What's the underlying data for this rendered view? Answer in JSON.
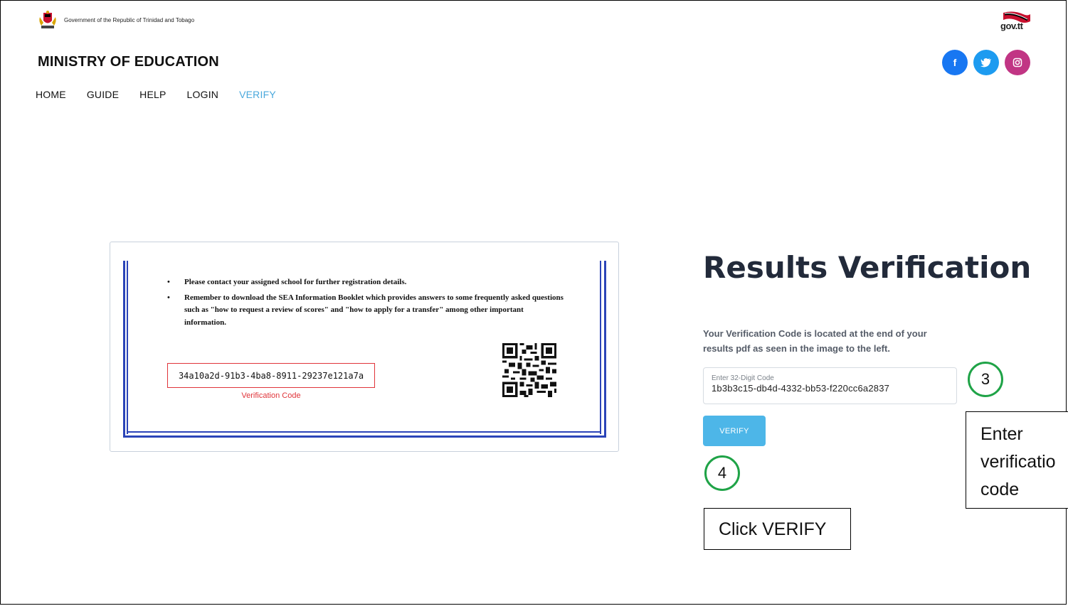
{
  "header": {
    "government_text": "Government of the Republic of Trinidad and Tobago",
    "portal_logo": "gov.tt",
    "ministry": "MINISTRY OF EDUCATION",
    "social": [
      {
        "name": "facebook-icon",
        "glyph": "f",
        "color": "#1877f2"
      },
      {
        "name": "twitter-icon",
        "glyph": "t",
        "color": "#1d9bf0"
      },
      {
        "name": "instagram-icon",
        "glyph": "◎",
        "color": "#c13584"
      }
    ]
  },
  "nav": {
    "items": [
      "HOME",
      "GUIDE",
      "HELP",
      "LOGIN",
      "VERIFY"
    ],
    "active": "VERIFY",
    "accent_color": "#4aa8dc"
  },
  "sample_doc": {
    "bullets": [
      "Please contact your assigned school for further registration details.",
      "Remember to download the SEA Information Booklet which provides answers to some frequently asked questions such as \"how to request a review of scores\" and \"how to apply for a transfer\" among other important information."
    ],
    "code": "34a10a2d-91b3-4ba8-8911-29237e121a7a",
    "code_caption": "Verification Code"
  },
  "verify_panel": {
    "title": "Results Verification",
    "description": "Your Verification Code is located at the end of your results pdf as seen in the image to the left.",
    "input_label": "Enter 32-Digit Code",
    "input_value": "1b3b3c15-db4d-4332-bb53-f220cc6a2837",
    "button_label": "VERIFY",
    "button_color": "#4db6e8"
  },
  "annotations": {
    "step3_number": "3",
    "step3_text": "Enter\nverificatio\ncode",
    "step4_number": "4",
    "step4_text": "Click VERIFY",
    "circle_color": "#1fa347"
  }
}
